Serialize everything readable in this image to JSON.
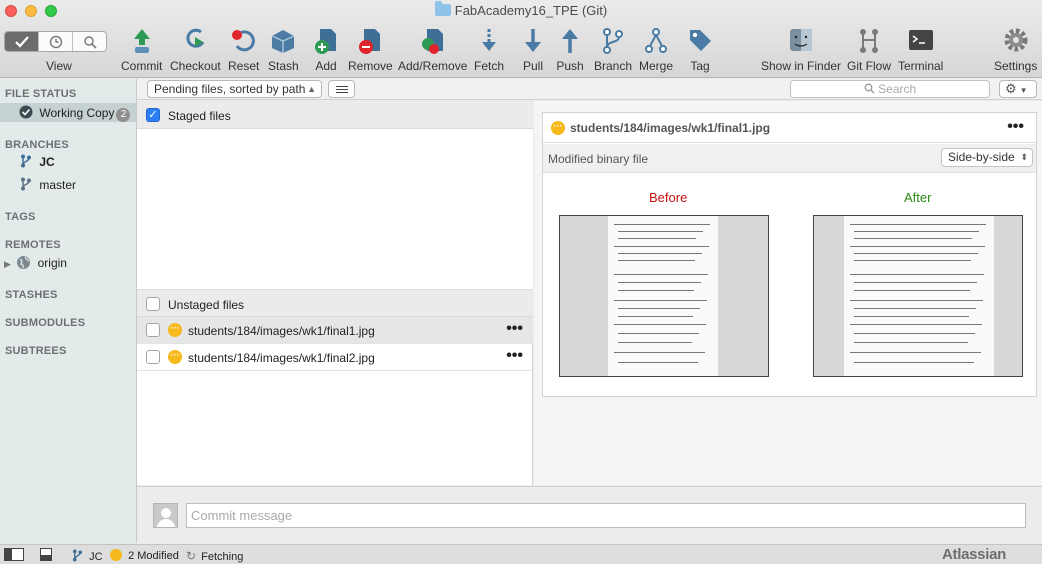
{
  "window": {
    "title": "FabAcademy16_TPE (Git)"
  },
  "toolbar": {
    "view_label": "View",
    "buttons": [
      {
        "label": "Commit",
        "icon": "commit-icon"
      },
      {
        "label": "Checkout",
        "icon": "checkout-icon"
      },
      {
        "label": "Reset",
        "icon": "reset-icon"
      },
      {
        "label": "Stash",
        "icon": "stash-icon"
      },
      {
        "label": "Add",
        "icon": "add-icon"
      },
      {
        "label": "Remove",
        "icon": "remove-icon"
      },
      {
        "label": "Add/Remove",
        "icon": "add-remove-icon"
      },
      {
        "label": "Fetch",
        "icon": "fetch-icon"
      },
      {
        "label": "Pull",
        "icon": "pull-icon"
      },
      {
        "label": "Push",
        "icon": "push-icon"
      },
      {
        "label": "Branch",
        "icon": "branch-icon"
      },
      {
        "label": "Merge",
        "icon": "merge-icon"
      },
      {
        "label": "Tag",
        "icon": "tag-icon"
      },
      {
        "label": "Show in Finder",
        "icon": "finder-icon"
      },
      {
        "label": "Git Flow",
        "icon": "git-flow-icon"
      },
      {
        "label": "Terminal",
        "icon": "terminal-icon"
      },
      {
        "label": "Settings",
        "icon": "settings-gear-icon"
      }
    ]
  },
  "sidebar": {
    "file_status_header": "FILE STATUS",
    "working_copy": {
      "label": "Working Copy",
      "count": "2"
    },
    "branches_header": "BRANCHES",
    "branches": [
      "JC",
      "master"
    ],
    "tags_header": "TAGS",
    "remotes_header": "REMOTES",
    "remotes": [
      "origin"
    ],
    "stashes_header": "STASHES",
    "submodules_header": "SUBMODULES",
    "subtrees_header": "SUBTREES"
  },
  "filter": {
    "sort_selected": "Pending files, sorted by path",
    "search_placeholder": "Search"
  },
  "staged": {
    "header": "Staged files"
  },
  "unstaged": {
    "header": "Unstaged files",
    "files": [
      "students/184/images/wk1/final1.jpg",
      "students/184/images/wk1/final2.jpg"
    ]
  },
  "diff": {
    "file": "students/184/images/wk1/final1.jpg",
    "subtitle": "Modified binary file",
    "view_mode": "Side-by-side",
    "before_label": "Before",
    "after_label": "After"
  },
  "commit": {
    "placeholder": "Commit message"
  },
  "status": {
    "branch": "JC",
    "modified": "2 Modified",
    "activity": "Fetching",
    "brand": "Atlassian"
  },
  "colors": {
    "accent_blue": "#2b7ef3",
    "modified_yellow": "#f7b91b",
    "before_red": "#c61010",
    "after_green": "#2a8a11"
  }
}
